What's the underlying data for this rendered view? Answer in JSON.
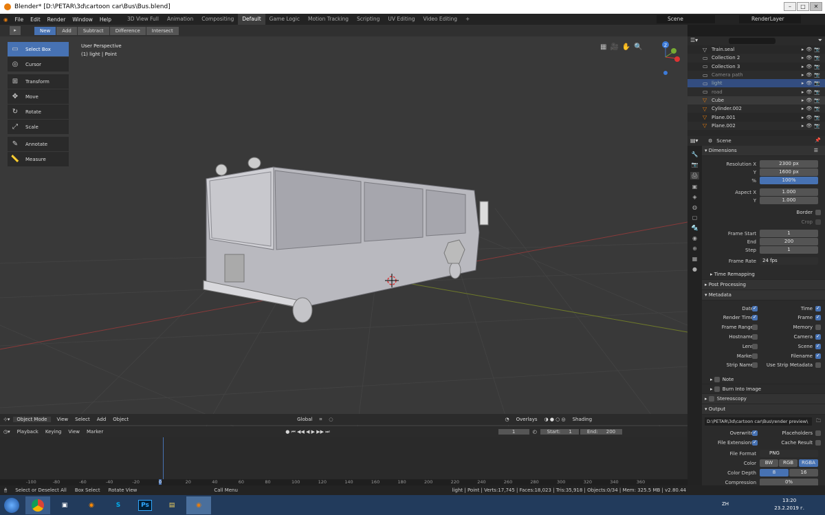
{
  "title": "Blender* [D:\\PETAR\\3d\\cartoon car\\Bus\\Bus.blend]",
  "menu": [
    "File",
    "Edit",
    "Render",
    "Window",
    "Help"
  ],
  "workspaces": [
    "3D View Full",
    "Animation",
    "Compositing",
    "Default",
    "Game Logic",
    "Motion Tracking",
    "Scripting",
    "UV Editing",
    "Video Editing"
  ],
  "active_workspace": "Default",
  "scene": "Scene",
  "render_layer": "RenderLayer",
  "modes": [
    "New",
    "Add",
    "Subtract",
    "Difference",
    "Intersect"
  ],
  "tools": [
    "Select Box",
    "Cursor",
    "Transform",
    "Move",
    "Rotate",
    "Scale",
    "Annotate",
    "Measure"
  ],
  "viewport": {
    "perspective": "User Perspective",
    "object": "(1) light | Point"
  },
  "vp_footer": {
    "mode": "Object Mode",
    "view": "View",
    "select": "Select",
    "add": "Add",
    "object": "Object",
    "orientation": "Global",
    "overlays": "Overlays",
    "shading": "Shading"
  },
  "timeline": {
    "playback": "Playback",
    "keying": "Keying",
    "view": "View",
    "marker": "Marker",
    "current": "1",
    "start_label": "Start:",
    "start": "1",
    "end_label": "End:",
    "end": "200",
    "ticks": [
      "-100",
      "-80",
      "-60",
      "-40",
      "-20",
      "0",
      "20",
      "40",
      "60",
      "80",
      "100",
      "120",
      "140",
      "160",
      "180",
      "200",
      "220",
      "240",
      "260",
      "280",
      "300",
      "320",
      "340",
      "360"
    ]
  },
  "status": {
    "select": "Select or Deselect All",
    "box": "Box Select",
    "rotate": "Rotate View",
    "menu": "Call Menu",
    "stats": "light | Point | Verts:17,745 | Faces:18,023 | Tris:35,918 | Objects:0/34 | Mem: 325.5 MB | v2.80.44"
  },
  "outliner": [
    {
      "name": "Train.seal"
    },
    {
      "name": "Collection 2"
    },
    {
      "name": "Collection 3"
    },
    {
      "name": "Camera path"
    },
    {
      "name": "light"
    },
    {
      "name": "road"
    },
    {
      "name": "Cube"
    },
    {
      "name": "Cylinder.002"
    },
    {
      "name": "Plane.001"
    },
    {
      "name": "Plane.002"
    }
  ],
  "props": {
    "scene": "Scene",
    "dimensions": "Dimensions",
    "resolution_x_label": "Resolution X",
    "resolution_x": "2300 px",
    "y_label": "Y",
    "resolution_y": "1600 px",
    "pct_label": "%",
    "pct": "100%",
    "aspect_x_label": "Aspect X",
    "aspect_x": "1.000",
    "aspect_y": "1.000",
    "border": "Border",
    "crop": "Crop",
    "frame_start_label": "Frame Start",
    "frame_start": "1",
    "end_label": "End",
    "frame_end": "200",
    "step_label": "Step",
    "step": "1",
    "frame_rate_label": "Frame Rate",
    "frame_rate": "24 fps",
    "time_remapping": "Time Remapping",
    "post_processing": "Post Processing",
    "metadata": "Metadata",
    "meta_left": [
      {
        "label": "Date",
        "on": true
      },
      {
        "label": "Render Time",
        "on": true
      },
      {
        "label": "Frame Range",
        "on": false
      },
      {
        "label": "Hostname",
        "on": false
      },
      {
        "label": "Lens",
        "on": false
      },
      {
        "label": "Marker",
        "on": false
      },
      {
        "label": "Strip Name",
        "on": false
      }
    ],
    "meta_right": [
      {
        "label": "Time",
        "on": true
      },
      {
        "label": "Frame",
        "on": true
      },
      {
        "label": "Memory",
        "on": false
      },
      {
        "label": "Camera",
        "on": true
      },
      {
        "label": "Scene",
        "on": true
      },
      {
        "label": "Filename",
        "on": true
      },
      {
        "label": "Use Strip Metadata",
        "on": false
      }
    ],
    "note": "Note",
    "burn": "Burn Into Image",
    "stereoscopy": "Stereoscopy",
    "output": "Output",
    "output_path": "D:\\PETAR\\3d\\cartoon car\\Bus\\render preview\\",
    "overwrite": "Overwrite",
    "placeholders": "Placeholders",
    "file_extensions": "File Extensions",
    "cache_result": "Cache Result",
    "file_format_label": "File Format",
    "file_format": "PNG",
    "color_label": "Color",
    "color_opts": [
      "BW",
      "RGB",
      "RGBA"
    ],
    "color_depth_label": "Color Depth",
    "depth_opts": [
      "8",
      "16"
    ],
    "compression_label": "Compression",
    "compression": "0%"
  },
  "taskbar": {
    "lang": "ZH",
    "time": "13:20",
    "date": "23.2.2019 г."
  }
}
